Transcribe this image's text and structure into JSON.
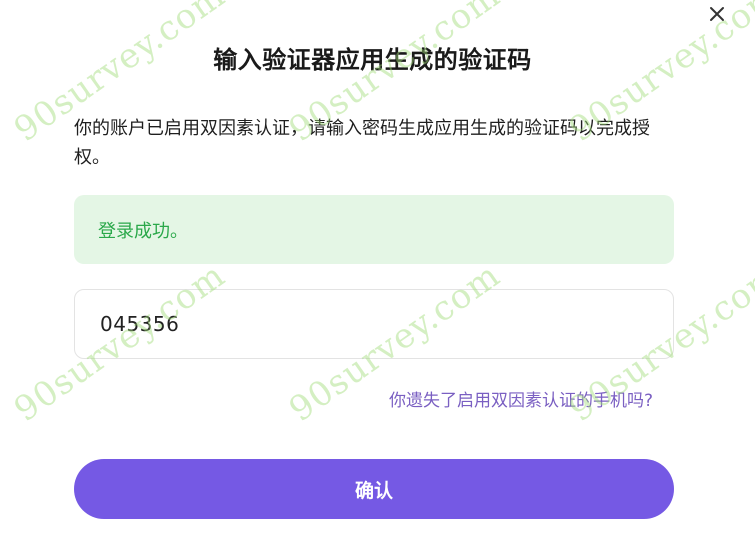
{
  "dialog": {
    "title": "输入验证器应用生成的验证码",
    "description": "你的账户已启用双因素认证，请输入密码生成应用生成的验证码以完成授权。",
    "success_message": "登录成功。",
    "code_input": {
      "value": "045356",
      "placeholder": ""
    },
    "lost_phone_link": "你遗失了启用双因素认证的手机吗?",
    "confirm_label": "确认",
    "close_icon": "close-icon"
  },
  "watermark": {
    "text": "90survey.com"
  },
  "colors": {
    "primary": "#7559e4",
    "success_bg": "#e4f6e5",
    "success_text": "#2aa84a",
    "link": "#7a5fc2",
    "watermark": "#a0dc78"
  }
}
